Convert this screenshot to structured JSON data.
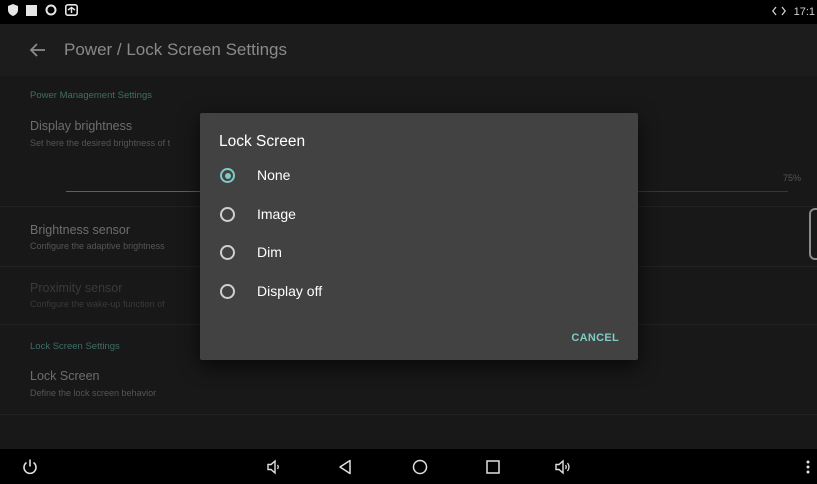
{
  "status_bar": {
    "time": "17:1",
    "left_icons": [
      "shield-icon",
      "square-icon",
      "ring-icon",
      "screen-share-icon"
    ],
    "right_icons": [
      "code-arrows-icon"
    ]
  },
  "toolbar": {
    "title": "Power / Lock Screen Settings"
  },
  "settings": {
    "power_section": "Power Management Settings",
    "brightness_title": "Display brightness",
    "brightness_summary": "Set here the desired brightness of t",
    "brightness_value": "75%",
    "brightness_level": 0.75,
    "sensor_title": "Brightness sensor",
    "sensor_summary": "Configure the adaptive brightness",
    "proximity_title": "Proximity sensor",
    "proximity_summary": "Configure the wake-up function of",
    "lock_section": "Lock Screen Settings",
    "lock_title": "Lock Screen",
    "lock_summary": "Define the lock screen behavior"
  },
  "dialog": {
    "title": "Lock Screen",
    "options": [
      {
        "label": "None",
        "checked": true
      },
      {
        "label": "Image",
        "checked": false
      },
      {
        "label": "Dim",
        "checked": false
      },
      {
        "label": "Display off",
        "checked": false
      }
    ],
    "cancel_label": "CANCEL"
  },
  "nav_bar": {
    "icons": [
      "power-icon",
      "volume-down-icon",
      "back-triangle-icon",
      "home-circle-icon",
      "recents-square-icon",
      "volume-up-icon",
      "overflow-menu-icon"
    ]
  },
  "colors": {
    "accent": "#80cbc4",
    "dialog_bg": "#424242",
    "screen_bg": "#141414"
  }
}
